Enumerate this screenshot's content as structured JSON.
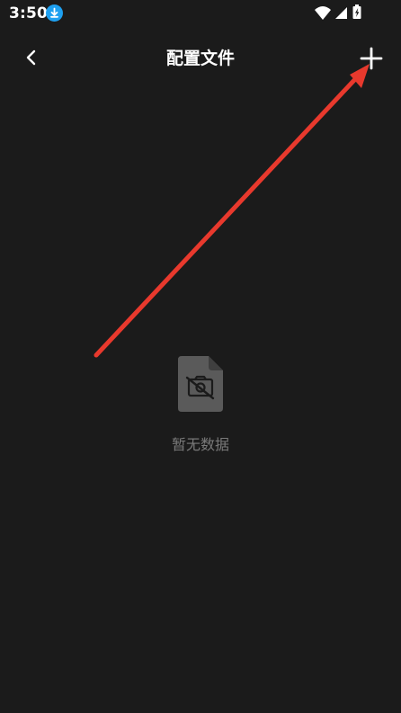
{
  "status_bar": {
    "time": "3:50",
    "icons": [
      "download-icon",
      "wifi-icon",
      "signal-icon",
      "battery-charging-icon"
    ]
  },
  "app_bar": {
    "title": "配置文件",
    "back_icon": "chevron-left-icon",
    "add_icon": "plus-icon"
  },
  "empty_state": {
    "icon": "file-no-image-icon",
    "text": "暂无数据"
  },
  "annotation": {
    "type": "arrow",
    "points_to": "add-button",
    "color": "#e8392d"
  },
  "colors": {
    "background": "#1b1b1b",
    "empty_text": "#7a7a7a",
    "download_badge": "#1ea0f0",
    "empty_icon": "#5a5a5a"
  }
}
